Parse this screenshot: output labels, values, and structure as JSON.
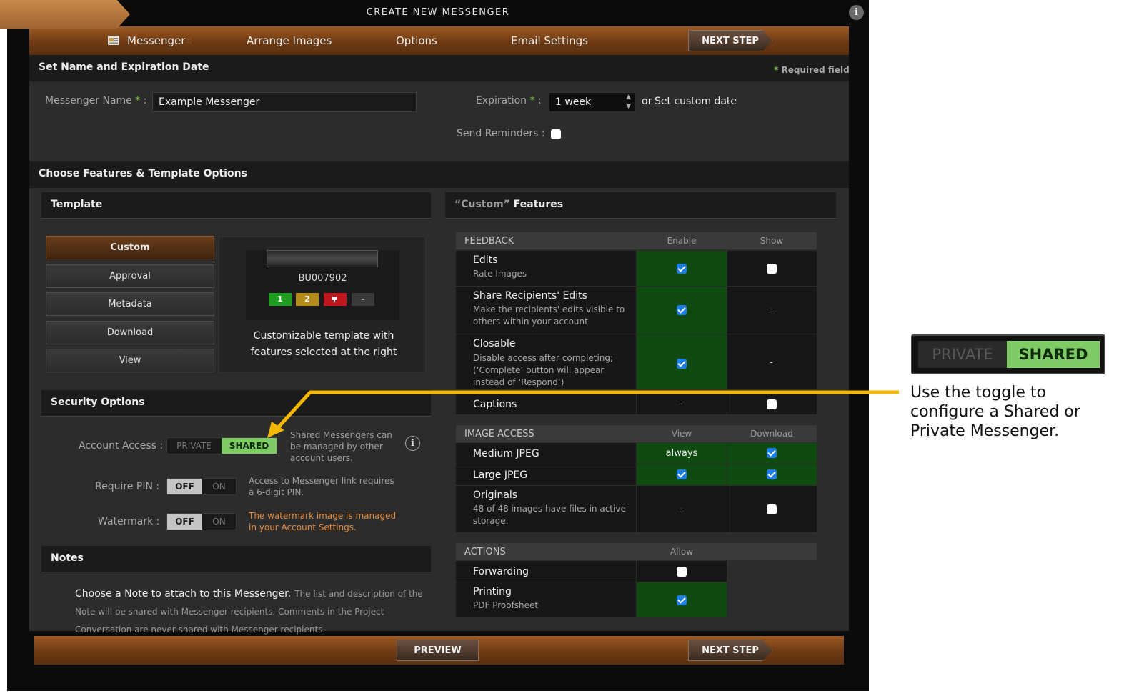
{
  "dialog": {
    "title": "CREATE NEW MESSENGER",
    "close": "✕",
    "info": "i"
  },
  "nav": {
    "messenger": "Messenger",
    "sep": "::",
    "arrange": "Arrange Images",
    "options": "Options",
    "email": "Email Settings",
    "next_step": "NEXT STEP"
  },
  "name_section": {
    "header": "Set Name and Expiration Date",
    "required": "Required field",
    "required_star": "*",
    "name_label": "Messenger Name",
    "name_value": "Example Messenger",
    "expiration_label": "Expiration",
    "expiration_value": "1 week",
    "or": "or",
    "custom_date": "Set custom date",
    "reminders_label": "Send Reminders :"
  },
  "features_section": {
    "header": "Choose Features & Template Options"
  },
  "template": {
    "header": "Template",
    "buttons": [
      "Custom",
      "Approval",
      "Metadata",
      "Download",
      "View"
    ],
    "preview_code": "BU007902",
    "preview_badges": [
      "1",
      "2",
      "",
      "–"
    ],
    "description": "Customizable template with features selected at the right"
  },
  "security": {
    "header": "Security Options",
    "account_label": "Account Access :",
    "private": "PRIVATE",
    "shared": "SHARED",
    "account_note": "Shared Messengers can be managed by other account users.",
    "pin_label": "Require PIN :",
    "off": "OFF",
    "on": "ON",
    "pin_note": "Access to Messenger link requires a 6-digit PIN.",
    "watermark_label": "Watermark :",
    "watermark_note": "The watermark image is managed in your Account Settings."
  },
  "notes": {
    "header": "Notes",
    "lead": "Choose a Note to attach to this Messenger.",
    "body": "The list and description of the Note will be shared with Messenger recipients. Comments in the Project Conversation are never shared with Messenger recipients."
  },
  "custom_features": {
    "header_quote": "“Custom”",
    "header_word": "Features",
    "feedback": {
      "title": "FEEDBACK",
      "col1": "Enable",
      "col2": "Show",
      "rows": [
        {
          "name": "Edits",
          "sub": "Rate Images"
        },
        {
          "name": "Share Recipients' Edits",
          "sub": "Make the recipients' edits visible to others within your account"
        },
        {
          "name": "Closable",
          "sub": "Disable access after completing; (‘Complete’ button will appear instead of ‘Respond’)"
        },
        {
          "name": "Captions",
          "sub": ""
        }
      ]
    },
    "image_access": {
      "title": "IMAGE ACCESS",
      "col1": "View",
      "col2": "Download",
      "rows": [
        {
          "name": "Medium JPEG",
          "sub": "",
          "view": "always"
        },
        {
          "name": "Large JPEG",
          "sub": ""
        },
        {
          "name": "Originals",
          "sub": "48 of 48 images have files in active storage."
        }
      ]
    },
    "actions": {
      "title": "ACTIONS",
      "col1": "Allow",
      "rows": [
        {
          "name": "Forwarding",
          "sub": ""
        },
        {
          "name": "Printing",
          "sub": "PDF Proofsheet"
        }
      ]
    },
    "dash": "-"
  },
  "footer": {
    "preview": "PREVIEW",
    "next_step": "NEXT STEP"
  },
  "callout": {
    "private": "PRIVATE",
    "shared": "SHARED",
    "text": "Use the toggle to configure a Shared or Private Messenger."
  },
  "colors": {
    "accent_green": "#7fcc66",
    "arrow": "#f5b800",
    "brand_brown": "#7a4318"
  }
}
